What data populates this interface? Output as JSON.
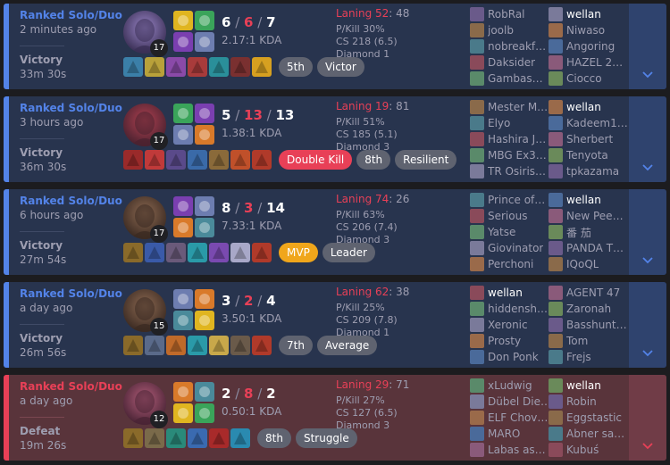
{
  "colors": {
    "win": "#28344e",
    "loss": "#59343b",
    "accent_blue": "#5383e8",
    "accent_red": "#e84057"
  },
  "matches": [
    {
      "result_class": "win",
      "queue": "Ranked Solo/Duo",
      "ago": "2 minutes ago",
      "result": "Victory",
      "duration": "33m 30s",
      "champion_level": "17",
      "kills": "6",
      "deaths": "6",
      "assists": "7",
      "kda_ratio": "2.17:1 KDA",
      "laning_label": "Laning 52",
      "laning_rest": ": 48",
      "pkill": "P/Kill 30%",
      "cs": "CS 218 (6.5)",
      "rank": "Diamond 1",
      "badges": [
        {
          "label": "5th",
          "style": "gray"
        },
        {
          "label": "Victor",
          "style": "gray"
        }
      ],
      "team1": [
        "RobRal",
        "joolb",
        "nobreakf…",
        "Daksider",
        "Gambas…"
      ],
      "team2": [
        "wellan",
        "Niwaso",
        "Angoring",
        "HAZEL 2…",
        "Ciocco"
      ],
      "me_team": 2,
      "me_index": 0
    },
    {
      "result_class": "win",
      "queue": "Ranked Solo/Duo",
      "ago": "3 hours ago",
      "result": "Victory",
      "duration": "36m 30s",
      "champion_level": "17",
      "kills": "5",
      "deaths": "13",
      "assists": "13",
      "kda_ratio": "1.38:1 KDA",
      "laning_label": "Laning 19",
      "laning_rest": ": 81",
      "pkill": "P/Kill 51%",
      "cs": "CS 185 (5.1)",
      "rank": "Diamond 3",
      "badges": [
        {
          "label": "Double Kill",
          "style": "red"
        },
        {
          "label": "8th",
          "style": "gray"
        },
        {
          "label": "Resilient",
          "style": "gray"
        }
      ],
      "team1": [
        "Mester M…",
        "Elyo",
        "Hashira J…",
        "MBG Ex3…",
        "TR Osiris…"
      ],
      "team2": [
        "wellan",
        "Kadeem1…",
        "Sherbert",
        "Tenyota",
        "tpkazama"
      ],
      "me_team": 2,
      "me_index": 0
    },
    {
      "result_class": "win",
      "queue": "Ranked Solo/Duo",
      "ago": "6 hours ago",
      "result": "Victory",
      "duration": "27m 54s",
      "champion_level": "17",
      "kills": "8",
      "deaths": "3",
      "assists": "14",
      "kda_ratio": "7.33:1 KDA",
      "laning_label": "Laning 74",
      "laning_rest": ": 26",
      "pkill": "P/Kill 63%",
      "cs": "CS 206 (7.4)",
      "rank": "Diamond 3",
      "badges": [
        {
          "label": "MVP",
          "style": "gold"
        },
        {
          "label": "Leader",
          "style": "gray"
        }
      ],
      "team1": [
        "Prince of…",
        "Serious",
        "Yatse",
        "Giovinator",
        "Perchoni"
      ],
      "team2": [
        "wellan",
        "New Pee…",
        "番 茄",
        "PANDA T…",
        "IQoQL"
      ],
      "me_team": 2,
      "me_index": 0
    },
    {
      "result_class": "win",
      "queue": "Ranked Solo/Duo",
      "ago": "a day ago",
      "result": "Victory",
      "duration": "26m 56s",
      "champion_level": "15",
      "kills": "3",
      "deaths": "2",
      "assists": "4",
      "kda_ratio": "3.50:1 KDA",
      "laning_label": "Laning 62",
      "laning_rest": ": 38",
      "pkill": "P/Kill 25%",
      "cs": "CS 209 (7.8)",
      "rank": "Diamond 1",
      "badges": [
        {
          "label": "7th",
          "style": "gray"
        },
        {
          "label": "Average",
          "style": "gray"
        }
      ],
      "team1": [
        "wellan",
        "hiddensh…",
        "Xeronic",
        "Prosty",
        "Don Ponk"
      ],
      "team2": [
        "AGENT 47",
        "Zaronah",
        "Basshunt…",
        "Tom",
        "Frejs"
      ],
      "me_team": 1,
      "me_index": 0
    },
    {
      "result_class": "loss",
      "queue": "Ranked Solo/Duo",
      "ago": "a day ago",
      "result": "Defeat",
      "duration": "19m 26s",
      "champion_level": "12",
      "kills": "2",
      "deaths": "8",
      "assists": "2",
      "kda_ratio": "0.50:1 KDA",
      "laning_label": "Laning 29",
      "laning_rest": ": 71",
      "pkill": "P/Kill 27%",
      "cs": "CS 127 (6.5)",
      "rank": "Diamond 3",
      "badges": [
        {
          "label": "8th",
          "style": "gray"
        },
        {
          "label": "Struggle",
          "style": "gray"
        }
      ],
      "team1": [
        "xLudwig",
        "Dübel Die…",
        "ELF Chov…",
        "MARO",
        "Labas as…"
      ],
      "team2": [
        "wellan",
        "Robin",
        "Eggstastic",
        "Abner sa…",
        "Kubuś"
      ],
      "me_team": 2,
      "me_index": 0
    }
  ]
}
